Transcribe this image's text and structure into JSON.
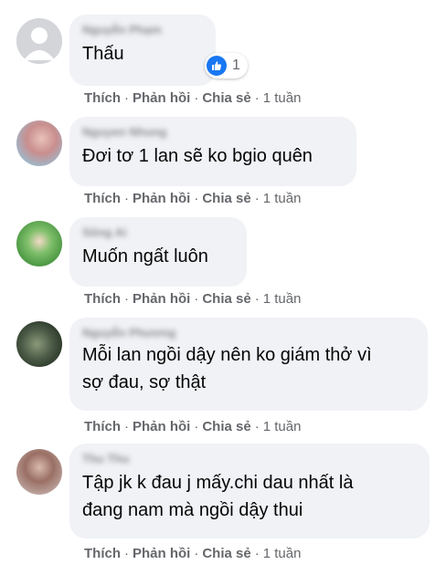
{
  "comments": [
    {
      "author": "Nguyễn Phạm",
      "text_lines": [
        "Thấu"
      ],
      "reaction_count": "1",
      "actions": {
        "like": "Thích",
        "reply": "Phản hồi",
        "share": "Chia sẻ",
        "time": "1 tuần"
      }
    },
    {
      "author": "Nguyen Nhung",
      "text_lines": [
        "Đơi tơ 1 lan sẽ ko bgio quên"
      ],
      "actions": {
        "like": "Thích",
        "reply": "Phản hồi",
        "share": "Chia sẻ",
        "time": "1 tuần"
      }
    },
    {
      "author": "Sông Ai",
      "text_lines": [
        "Muốn ngất luôn"
      ],
      "actions": {
        "like": "Thích",
        "reply": "Phản hồi",
        "share": "Chia sẻ",
        "time": "1 tuần"
      }
    },
    {
      "author": "Nguyễn Phương",
      "text_lines": [
        "Mỗi lan ngồi dậy nên ko giám thở vì",
        "sợ đau, sợ thật"
      ],
      "actions": {
        "like": "Thích",
        "reply": "Phản hồi",
        "share": "Chia sẻ",
        "time": "1 tuần"
      }
    },
    {
      "author": "Thu Thu",
      "text_lines": [
        "Tập jk k đau j mấy.chi dau nhất là",
        "đang nam mà ngồi dậy thui"
      ],
      "actions": {
        "like": "Thích",
        "reply": "Phản hồi",
        "share": "Chia sẻ",
        "time": "1 tuần"
      }
    }
  ],
  "colors": {
    "bubble": "#f0f2f5",
    "text": "#050505",
    "secondary": "#65676b",
    "like_blue": "#1877f2"
  }
}
